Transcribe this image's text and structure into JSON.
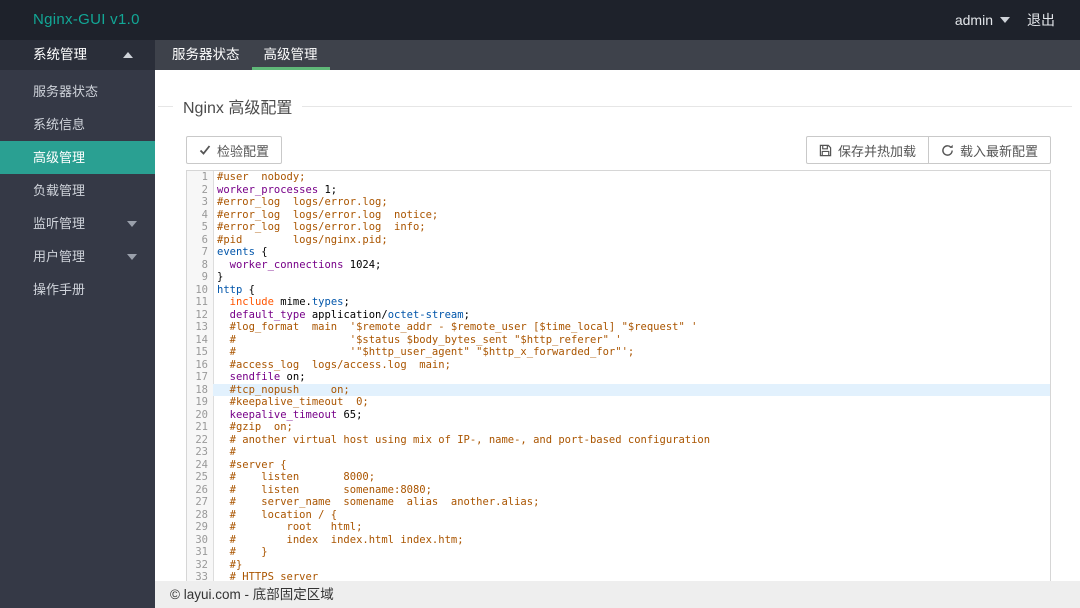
{
  "header": {
    "logo": "Nginx-GUI v1.0",
    "user": "admin",
    "logout": "退出"
  },
  "sidebar": {
    "title": "系统管理",
    "items": [
      {
        "label": "服务器状态",
        "active": false,
        "arrow": null
      },
      {
        "label": "系统信息",
        "active": false,
        "arrow": null
      },
      {
        "label": "高级管理",
        "active": true,
        "arrow": null
      },
      {
        "label": "负载管理",
        "active": false,
        "arrow": null
      },
      {
        "label": "监听管理",
        "active": false,
        "arrow": "down"
      },
      {
        "label": "用户管理",
        "active": false,
        "arrow": "down"
      },
      {
        "label": "操作手册",
        "active": false,
        "arrow": null
      }
    ]
  },
  "tabs": [
    {
      "label": "服务器状态",
      "active": false
    },
    {
      "label": "高级管理",
      "active": true
    }
  ],
  "page": {
    "title": "Nginx 高级配置"
  },
  "toolbar": {
    "check": "检验配置",
    "save": "保存并热加载",
    "reload": "载入最新配置"
  },
  "editor": {
    "active_line": 18,
    "lines": [
      {
        "n": 1,
        "tokens": [
          {
            "c": "c",
            "t": "#user  nobody;"
          }
        ]
      },
      {
        "n": 2,
        "tokens": [
          {
            "c": "k",
            "t": "worker_processes"
          },
          {
            "c": "p",
            "t": " 1;"
          }
        ]
      },
      {
        "n": 3,
        "tokens": [
          {
            "c": "c",
            "t": "#error_log  logs/error.log;"
          }
        ]
      },
      {
        "n": 4,
        "tokens": [
          {
            "c": "c",
            "t": "#error_log  logs/error.log  notice;"
          }
        ]
      },
      {
        "n": 5,
        "tokens": [
          {
            "c": "c",
            "t": "#error_log  logs/error.log  info;"
          }
        ]
      },
      {
        "n": 6,
        "tokens": [
          {
            "c": "c",
            "t": "#pid        logs/nginx.pid;"
          }
        ]
      },
      {
        "n": 7,
        "tokens": [
          {
            "c": "v",
            "t": "events"
          },
          {
            "c": "p",
            "t": " {"
          }
        ]
      },
      {
        "n": 8,
        "tokens": [
          {
            "c": "p",
            "t": "  "
          },
          {
            "c": "k",
            "t": "worker_connections"
          },
          {
            "c": "p",
            "t": " 1024;"
          }
        ]
      },
      {
        "n": 9,
        "tokens": [
          {
            "c": "p",
            "t": "}"
          }
        ]
      },
      {
        "n": 10,
        "tokens": [
          {
            "c": "v",
            "t": "http"
          },
          {
            "c": "p",
            "t": " {"
          }
        ]
      },
      {
        "n": 11,
        "tokens": [
          {
            "c": "p",
            "t": "  "
          },
          {
            "c": "s",
            "t": "include"
          },
          {
            "c": "p",
            "t": " mime."
          },
          {
            "c": "v",
            "t": "types"
          },
          {
            "c": "p",
            "t": ";"
          }
        ]
      },
      {
        "n": 12,
        "tokens": [
          {
            "c": "p",
            "t": "  "
          },
          {
            "c": "k",
            "t": "default_type"
          },
          {
            "c": "p",
            "t": " application/"
          },
          {
            "c": "v",
            "t": "octet-stream"
          },
          {
            "c": "p",
            "t": ";"
          }
        ]
      },
      {
        "n": 13,
        "tokens": [
          {
            "c": "c",
            "t": "  #log_format  main  '$remote_addr - $remote_user [$time_local] \"$request\" '"
          }
        ]
      },
      {
        "n": 14,
        "tokens": [
          {
            "c": "c",
            "t": "  #                  '$status $body_bytes_sent \"$http_referer\" '"
          }
        ]
      },
      {
        "n": 15,
        "tokens": [
          {
            "c": "c",
            "t": "  #                  '\"$http_user_agent\" \"$http_x_forwarded_for\"';"
          }
        ]
      },
      {
        "n": 16,
        "tokens": [
          {
            "c": "c",
            "t": "  #access_log  logs/access.log  main;"
          }
        ]
      },
      {
        "n": 17,
        "tokens": [
          {
            "c": "p",
            "t": "  "
          },
          {
            "c": "k",
            "t": "sendfile"
          },
          {
            "c": "p",
            "t": " on;"
          }
        ]
      },
      {
        "n": 18,
        "tokens": [
          {
            "c": "c",
            "t": "  #tcp_nopush     on;"
          }
        ]
      },
      {
        "n": 19,
        "tokens": [
          {
            "c": "c",
            "t": "  #keepalive_timeout  0;"
          }
        ]
      },
      {
        "n": 20,
        "tokens": [
          {
            "c": "p",
            "t": "  "
          },
          {
            "c": "k",
            "t": "keepalive_timeout"
          },
          {
            "c": "p",
            "t": " 65;"
          }
        ]
      },
      {
        "n": 21,
        "tokens": [
          {
            "c": "c",
            "t": "  #gzip  on;"
          }
        ]
      },
      {
        "n": 22,
        "tokens": [
          {
            "c": "c",
            "t": "  # another virtual host using mix of IP-, name-, and port-based configuration"
          }
        ]
      },
      {
        "n": 23,
        "tokens": [
          {
            "c": "c",
            "t": "  #"
          }
        ]
      },
      {
        "n": 24,
        "tokens": [
          {
            "c": "c",
            "t": "  #server {"
          }
        ]
      },
      {
        "n": 25,
        "tokens": [
          {
            "c": "c",
            "t": "  #    listen       8000;"
          }
        ]
      },
      {
        "n": 26,
        "tokens": [
          {
            "c": "c",
            "t": "  #    listen       somename:8080;"
          }
        ]
      },
      {
        "n": 27,
        "tokens": [
          {
            "c": "c",
            "t": "  #    server_name  somename  alias  another.alias;"
          }
        ]
      },
      {
        "n": 28,
        "tokens": [
          {
            "c": "c",
            "t": "  #    location / {"
          }
        ]
      },
      {
        "n": 29,
        "tokens": [
          {
            "c": "c",
            "t": "  #        root   html;"
          }
        ]
      },
      {
        "n": 30,
        "tokens": [
          {
            "c": "c",
            "t": "  #        index  index.html index.htm;"
          }
        ]
      },
      {
        "n": 31,
        "tokens": [
          {
            "c": "c",
            "t": "  #    }"
          }
        ]
      },
      {
        "n": 32,
        "tokens": [
          {
            "c": "c",
            "t": "  #}"
          }
        ]
      },
      {
        "n": 33,
        "tokens": [
          {
            "c": "c",
            "t": "  # HTTPS server"
          }
        ]
      }
    ]
  },
  "footer": {
    "text": "© layui.com - 底部固定区域"
  },
  "colors": {
    "accent": "#5FB878",
    "active_nav": "#2aa092",
    "logo": "#12a796",
    "highlight_line": "#e2f1fd",
    "comment": "#aa5500",
    "keyword": "#770088",
    "variable": "#0055aa",
    "string": "#ff5500"
  }
}
